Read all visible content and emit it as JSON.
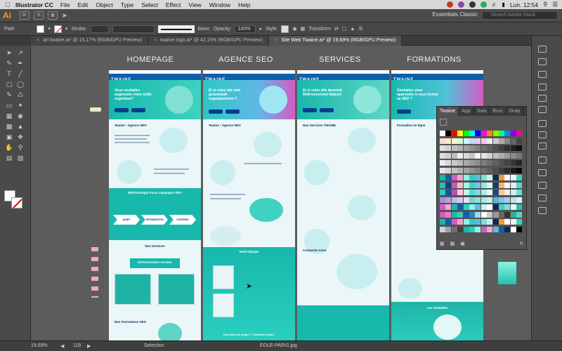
{
  "menubar": {
    "app_name": "Illustrator CC",
    "items": [
      "File",
      "Edit",
      "Object",
      "Type",
      "Select",
      "Effect",
      "View",
      "Window",
      "Help"
    ],
    "clock": "Lun. 12:54"
  },
  "appbar": {
    "logo": "Ai",
    "br": "Br",
    "st": "St",
    "workspace": "Essentials Classic",
    "search_placeholder": "Search Adobe Stock"
  },
  "controlbar": {
    "object_type": "Path",
    "stroke_label": "Stroke:",
    "stroke_value": "",
    "brush": "Basic",
    "opacity_label": "Opacity:",
    "opacity_value": "100%",
    "style_label": "Style:",
    "transform_label": "Transform"
  },
  "doc_tabs": [
    {
      "label": "art twaine.ai* @ 15,17% (RGB/GPU Preview)",
      "active": false
    },
    {
      "label": "twaine logo.ai* @ 42,15% (RGB/GPU Preview)",
      "active": false
    },
    {
      "label": "Site Web Twaine.ai* @ 19,69% (RGB/GPU Preview)",
      "active": true
    }
  ],
  "artboards": [
    {
      "title": "HOMEPAGE",
      "hero_text": "Vous souhaitez augmenter votre trafic organique?",
      "section1": "Twaine : Agence SEO",
      "band_title": "Méthodologie d'une campagne SEO",
      "steps": [
        "AUDIT",
        "OPTIMISATION",
        "CONTENU"
      ],
      "services": "Nos Services",
      "ref": "RÉFÉRENCEMENT NATUREL",
      "formations": "Nos Formations SEO"
    },
    {
      "title": "AGENCE SEO",
      "hero_text": "Et si votre site web grossissait organiquement ?",
      "section1": "Twaine : Agence SEO",
      "team": "Notre Équipe",
      "cta": "Vous avez un projet ? Contactez nous !"
    },
    {
      "title": "SERVICES",
      "hero_text": "Et si votre site devenait Référencement Naturel",
      "section1": "Nos Services TWAINE",
      "contact": "Contactez nous"
    },
    {
      "title": "FORMATIONS",
      "hero_text": "Souhaitez vous apprendre à vous former au SEO ?",
      "section1": "Formation en ligne",
      "bottom": "Les modalités"
    }
  ],
  "panel": {
    "tabs": [
      "Twaine",
      "App",
      "Swa",
      "Brus",
      "Grap"
    ]
  },
  "statusbar": {
    "zoom": "19,69%",
    "page": "118",
    "mode": "Selection",
    "file": "EOLE-PARIS.jpg"
  },
  "colors": {
    "teal": "#18b8ad",
    "navy": "#0c5fa8",
    "ai_orange": "#f29a2e"
  }
}
